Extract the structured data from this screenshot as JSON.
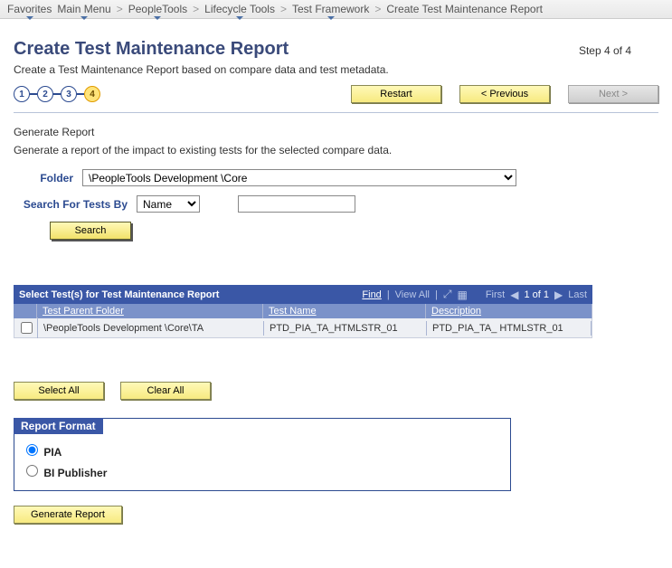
{
  "breadcrumb": {
    "items": [
      {
        "label": "Favorites",
        "drop": true
      },
      {
        "label": "Main Menu",
        "drop": true
      },
      {
        "label": "PeopleTools",
        "drop": true
      },
      {
        "label": "Lifecycle Tools",
        "drop": true
      },
      {
        "label": "Test Framework",
        "drop": true
      },
      {
        "label": "Create Test Maintenance Report",
        "drop": false
      }
    ],
    "separator": ">"
  },
  "page": {
    "title": "Create Test Maintenance Report",
    "step_label": "Step 4 of 4",
    "subtitle": "Create a Test Maintenance Report based on compare data and test metadata."
  },
  "wizard": {
    "steps": [
      "1",
      "2",
      "3",
      "4"
    ],
    "current_index": 3,
    "buttons": {
      "restart": "Restart",
      "previous": "< Previous",
      "next": "Next >"
    }
  },
  "section": {
    "title": "Generate Report",
    "desc": "Generate a report of the impact to existing tests for the selected compare data."
  },
  "form": {
    "folder_label": "Folder",
    "folder_value": "\\PeopleTools Development \\Core",
    "search_label": "Search For Tests By",
    "search_by_value": "Name",
    "search_text_value": "",
    "search_button": "Search"
  },
  "grid": {
    "title": "Select Test(s) for Test Maintenance Report",
    "tools": {
      "find": "Find",
      "viewall": "View All",
      "first": "First",
      "range": "1 of 1",
      "last": "Last"
    },
    "columns": {
      "parent": "Test Parent Folder",
      "name": "Test Name",
      "desc": "Description"
    },
    "rows": [
      {
        "checked": false,
        "parent": "\\PeopleTools Development \\Core\\TA",
        "name": "PTD_PIA_TA_HTMLSTR_01",
        "desc": "PTD_PIA_TA_ HTMLSTR_01"
      }
    ]
  },
  "actions": {
    "select_all": "Select All",
    "clear_all": "Clear All"
  },
  "report_format": {
    "title": "Report Format",
    "options": {
      "pia": "PIA",
      "bip": "BI Publisher"
    },
    "selected": "pia"
  },
  "generate": {
    "button": "Generate Report"
  }
}
